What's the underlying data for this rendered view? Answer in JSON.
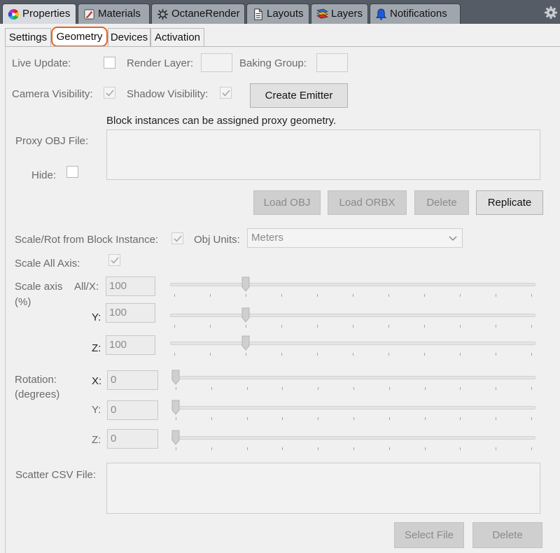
{
  "top_tabs": [
    {
      "label": "Properties",
      "icon": "color-wheel-icon"
    },
    {
      "label": "Materials",
      "icon": "paint-brush-icon"
    },
    {
      "label": "OctaneRender",
      "icon": "octane-icon"
    },
    {
      "label": "Layouts",
      "icon": "document-icon"
    },
    {
      "label": "Layers",
      "icon": "layers-icon"
    },
    {
      "label": "Notifications",
      "icon": "bell-icon"
    }
  ],
  "sub_tabs": [
    "Settings",
    "Geometry",
    "Devices",
    "Activation"
  ],
  "active_sub_tab": "Geometry",
  "row1": {
    "live_update": "Live Update:",
    "render_layer": "Render Layer:",
    "baking_group": "Baking Group:"
  },
  "row2": {
    "camera_visibility": "Camera Visibility:",
    "shadow_visibility": "Shadow Visibility:",
    "create_emitter": "Create Emitter"
  },
  "proxy": {
    "hint": "Block instances can be assigned proxy geometry.",
    "label": "Proxy OBJ File:",
    "hide": "Hide:",
    "load_obj": "Load OBJ",
    "load_orbx": "Load ORBX",
    "delete": "Delete",
    "replicate": "Replicate"
  },
  "scale_rot": {
    "label": "Scale/Rot from Block Instance:",
    "obj_units": "Obj Units:",
    "units_value": "Meters"
  },
  "scale_all": "Scale All Axis:",
  "scale_axis": {
    "label_line1": "Scale axis",
    "label_line2": "(%)",
    "rows": [
      {
        "axis": "All/X:",
        "value": "100",
        "fraction": 0.1
      },
      {
        "axis": "Y:",
        "value": "100",
        "fraction": 0.1
      },
      {
        "axis": "Z:",
        "value": "100",
        "fraction": 0.1
      }
    ]
  },
  "rotation": {
    "label_line1": "Rotation:",
    "label_line2": "(degrees)",
    "rows": [
      {
        "axis": "X:",
        "value": "0",
        "fraction": 0.0
      },
      {
        "axis": "Y:",
        "value": "0",
        "fraction": 0.0
      },
      {
        "axis": "Z:",
        "value": "0",
        "fraction": 0.0
      }
    ]
  },
  "scatter": {
    "label": "Scatter CSV File:",
    "select_file": "Select File",
    "delete": "Delete"
  },
  "colors": {
    "accent": "#e8641e",
    "tabbar": "#555c66"
  }
}
